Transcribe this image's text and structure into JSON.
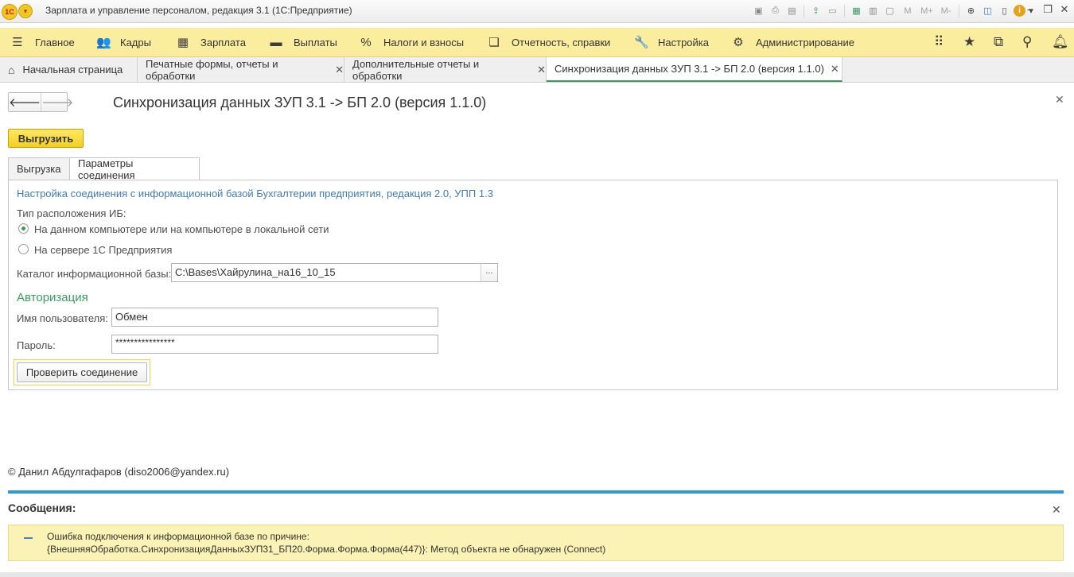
{
  "window": {
    "title": "Зарплата и управление персоналом, редакция 3.1  (1С:Предприятие)",
    "logo_text": "1С",
    "tool_m": "M",
    "tool_mplus": "M+",
    "tool_mminus": "M-"
  },
  "sections": {
    "items": [
      {
        "label": "Главное",
        "icon": "menu-icon"
      },
      {
        "label": "Кадры",
        "icon": "people-icon"
      },
      {
        "label": "Зарплата",
        "icon": "calculator-icon"
      },
      {
        "label": "Выплаты",
        "icon": "wallet-icon"
      },
      {
        "label": "Налоги и взносы",
        "icon": "percent-icon"
      },
      {
        "label": "Отчетность, справки",
        "icon": "documents-icon"
      },
      {
        "label": "Настройка",
        "icon": "wrench-icon"
      },
      {
        "label": "Администрирование",
        "icon": "gear-icon"
      }
    ]
  },
  "open_tabs": [
    {
      "label": "Начальная страница"
    },
    {
      "label": "Печатные формы, отчеты и обработки"
    },
    {
      "label": "Дополнительные отчеты и обработки"
    },
    {
      "label": "Синхронизация данных ЗУП 3.1 -> БП 2.0 (версия 1.1.0)"
    }
  ],
  "form": {
    "title": "Синхронизация данных ЗУП 3.1 -> БП 2.0 (версия 1.1.0)",
    "export_button": "Выгрузить",
    "tabs": [
      {
        "label": "Выгрузка",
        "active": false
      },
      {
        "label": "Параметры соединения",
        "active": true
      }
    ],
    "connection_header": "Настройка соединения с информационной базой Бухгалтерии предприятия, редакция 2.0, УПП 1.3",
    "location_type_label": "Тип расположения ИБ:",
    "location_options": [
      {
        "label": "На данном компьютере или на компьютере в локальной сети",
        "selected": true
      },
      {
        "label": "На сервере 1С Предприятия",
        "selected": false
      }
    ],
    "catalog_label": "Каталог информационной базы:",
    "catalog_value": "C:\\Bases\\Хайрулина_на16_10_15",
    "choice_button": "...",
    "auth_title": "Авторизация",
    "user_label": "Имя пользователя:",
    "user_value": "Обмен",
    "password_label": "Пароль:",
    "password_value": "****************",
    "check_button": "Проверить соединение",
    "copyright": "© Данил Абдулгафаров (diso2006@yandex.ru)"
  },
  "messages": {
    "title": "Сообщения:",
    "lines": [
      "Ошибка подключения к информационной базе по причине:",
      "{ВнешняяОбработка.СинхронизацияДанныхЗУП31_БП20.Форма.Форма.Форма(447)}: Метод объекта не обнаружен (Connect)"
    ]
  },
  "colors": {
    "section_bg": "#fbed9e",
    "accent_green": "#3a9a61",
    "button_yellow": "#f4cf22",
    "message_bg": "#fbf3b6",
    "message_bar": "#2e9bd6",
    "link_blue": "#3f7bb3"
  }
}
